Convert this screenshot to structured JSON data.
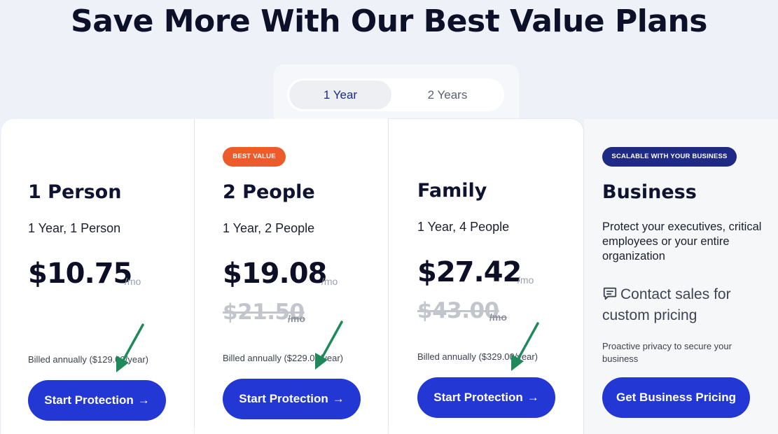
{
  "page_title": "Save More With Our Best Value Plans",
  "billing_toggle": {
    "options": [
      "1 Year",
      "2 Years"
    ],
    "selected": "1 Year"
  },
  "plans": [
    {
      "name": "1 Person",
      "subtitle": "1 Year, 1 Person",
      "price": "$10.75",
      "per": "/mo",
      "billed": "Billed annually ($129.00/year)",
      "cta": "Start Protection",
      "cta_arrow": "→"
    },
    {
      "badge": "BEST VALUE",
      "name": "2 People",
      "subtitle": "1 Year, 2 People",
      "price": "$19.08",
      "per": "/mo",
      "old_price": "$21.50",
      "old_per": "/mo",
      "billed": "Billed annually ($229.00/year)",
      "cta": "Start Protection",
      "cta_arrow": "→"
    },
    {
      "name": "Family",
      "subtitle": "1 Year, 4 People",
      "price": "$27.42",
      "per": "/mo",
      "old_price": "$43.00",
      "old_per": "/mo",
      "billed": "Billed annually ($329.00/year)",
      "cta": "Start Protection",
      "cta_arrow": "→"
    }
  ],
  "business": {
    "badge": "SCALABLE WITH YOUR BUSINESS",
    "name": "Business",
    "description": "Protect your executives, critical employees or your entire organization",
    "contact": "Contact sales for custom pricing",
    "contact_icon": "chat-bubble-icon",
    "note": "Proactive privacy to secure your business",
    "cta": "Get Business Pricing"
  },
  "colors": {
    "primary_button": "#2237d3",
    "best_value_badge": "#ec5b2a",
    "business_badge": "#1e2a86",
    "annotation_arrow": "#1e8a5c"
  }
}
